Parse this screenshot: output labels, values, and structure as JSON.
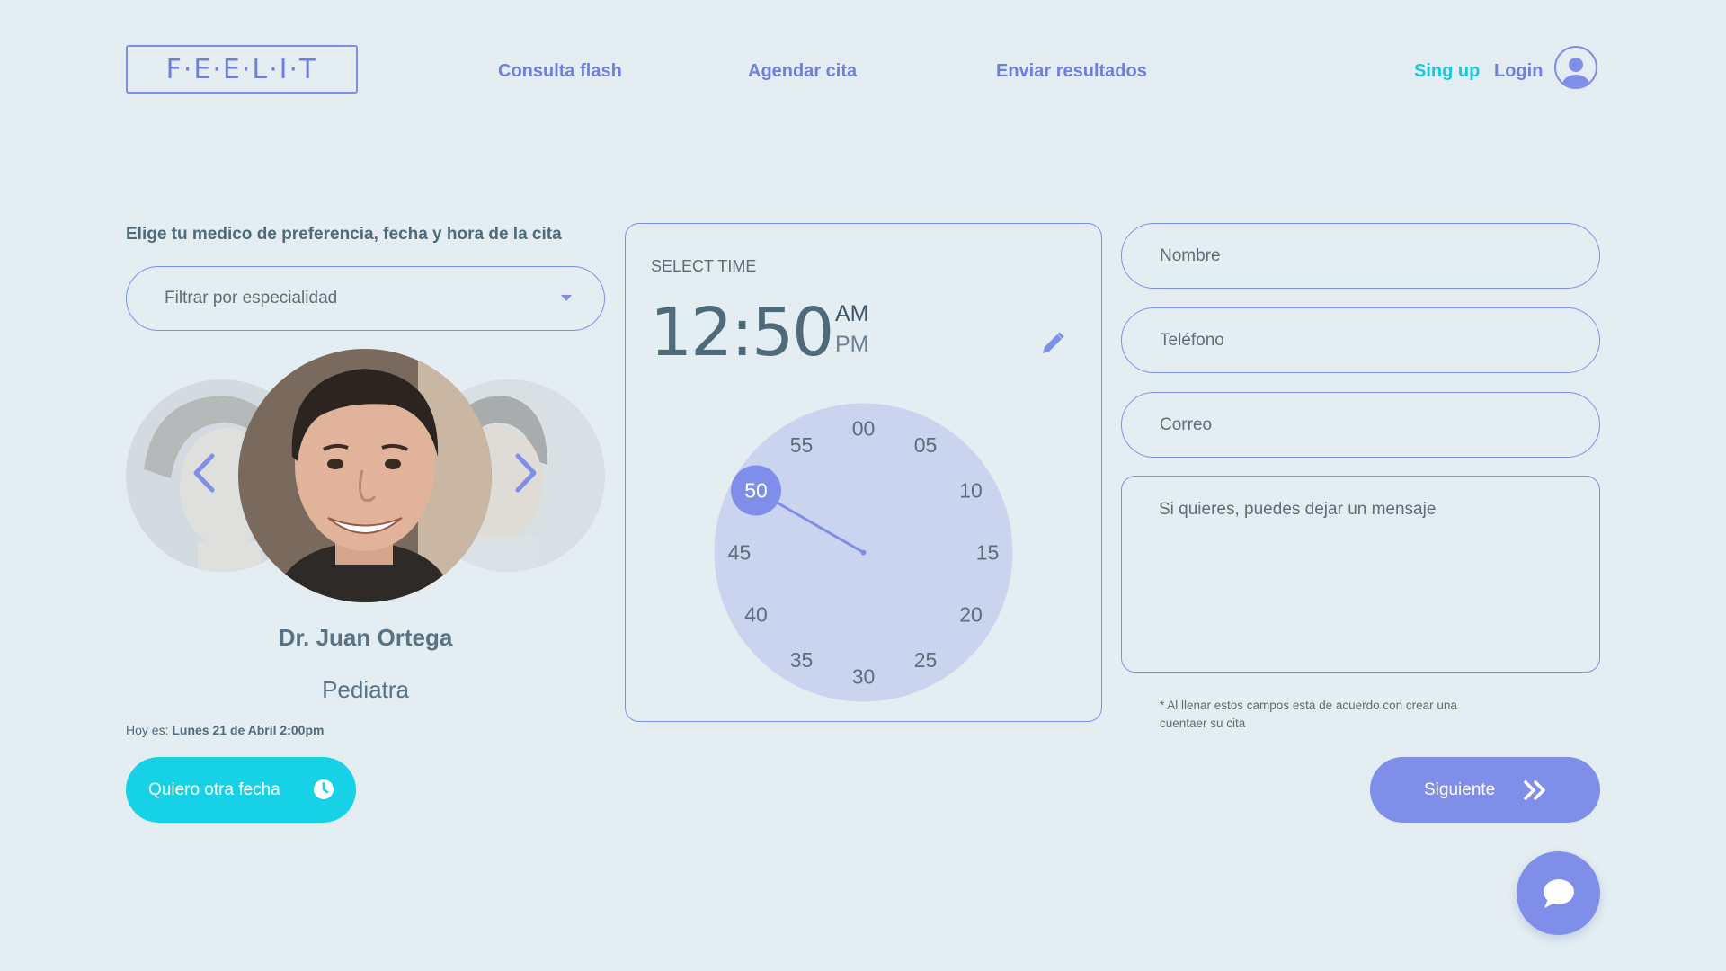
{
  "header": {
    "logo": "F·E·E·L·I·T",
    "nav": [
      "Consulta flash",
      "Agendar cita",
      "Enviar resultados"
    ],
    "signup_label": "Sing up",
    "login_label": "Login",
    "avatar_icon": "user-icon"
  },
  "left": {
    "instruction": "Elige tu medico de preferencia, fecha y hora de la cita",
    "filter_placeholder": "Filtrar por especialidad",
    "doctor_name": "Dr. Juan Ortega",
    "doctor_specialty": "Pediatra",
    "today_label": "Hoy es:",
    "today_value": "Lunes 21 de Abril 2:00pm",
    "other_date_button": "Quiero otra fecha"
  },
  "time_picker": {
    "label": "SELECT TIME",
    "time": "12:50",
    "am": "AM",
    "pm": "PM",
    "selected_minute": "50",
    "minutes": [
      "00",
      "05",
      "10",
      "15",
      "20",
      "25",
      "30",
      "35",
      "40",
      "45",
      "50",
      "55"
    ]
  },
  "form": {
    "name_placeholder": "Nombre",
    "phone_placeholder": "Teléfono",
    "email_placeholder": "Correo",
    "message_placeholder": "Si quieres, puedes dejar un mensaje",
    "note_line1": "* Al llenar estos campos esta de acuerdo con crear una",
    "note_line2": "cuentaer su cita",
    "next_button": "Siguiente"
  },
  "colors": {
    "accent": "#7f8ee8",
    "cyan": "#17d1e6",
    "background": "#e4edf2",
    "text": "#4f6b7a"
  }
}
